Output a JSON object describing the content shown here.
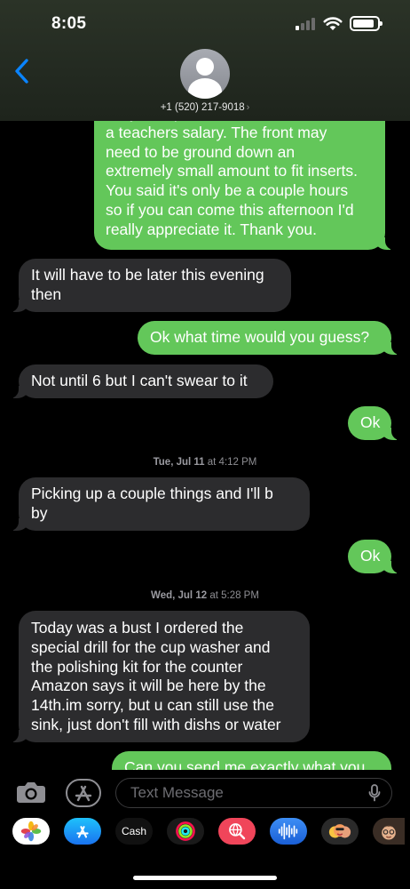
{
  "status_bar": {
    "time": "8:05"
  },
  "header": {
    "contact": "+1 (520) 217-9018",
    "chevron": "›"
  },
  "messages": [
    {
      "dir": "out",
      "text": "daily is expensive and not feasible on\na teachers salary.  The front may\nneed to be ground down an\nextremely small amount to fit inserts.\nYou said it's only be a couple hours\nso if you can come this afternoon I'd\nreally appreciate it.   Thank you."
    },
    {
      "dir": "in",
      "text": "It will have to be later this evening\nthen"
    },
    {
      "dir": "out",
      "text": "Ok what time would you guess?"
    },
    {
      "dir": "in",
      "text": "Not until 6 but I can't swear to it"
    },
    {
      "dir": "out",
      "text": "Ok"
    },
    {
      "dir": "in",
      "text": " Picking up a couple things  and I'll b\nby"
    },
    {
      "dir": "out",
      "text": "Ok"
    },
    {
      "dir": "in",
      "text": "Today was a bust I ordered the\nspecial drill for the cup washer and\nthe polishing kit for the counter\nAmazon says it will be here by the\n14th.im sorry, but u can still use the\nsink, just don't fill with dishs or water"
    },
    {
      "dir": "out",
      "text": "Can you send me exactly what you"
    }
  ],
  "timestamps": [
    {
      "day": "Tue, Jul 11",
      "time": "at 4:12 PM"
    },
    {
      "day": "Wed, Jul 12",
      "time": "at 5:28 PM"
    }
  ],
  "compose": {
    "placeholder": "Text Message"
  },
  "app_drawer": [
    {
      "name": "photos-app",
      "icon": "photos-icon"
    },
    {
      "name": "app-store-app",
      "icon": "app-store-icon"
    },
    {
      "name": "apple-cash-app",
      "icon": "apple-cash-icon",
      "label": "Cash"
    },
    {
      "name": "fitness-app",
      "icon": "activity-rings-icon"
    },
    {
      "name": "search-images-app",
      "icon": "globe-search-icon"
    },
    {
      "name": "audio-message-app",
      "icon": "audio-waveform-icon"
    },
    {
      "name": "memoji-stickers-app",
      "icon": "memoji-icon"
    },
    {
      "name": "memoji-app",
      "icon": "memoji-face-icon"
    }
  ],
  "colors": {
    "outgoing": "#63c75a",
    "incoming": "#2c2c2e",
    "link": "#0a84ff"
  }
}
